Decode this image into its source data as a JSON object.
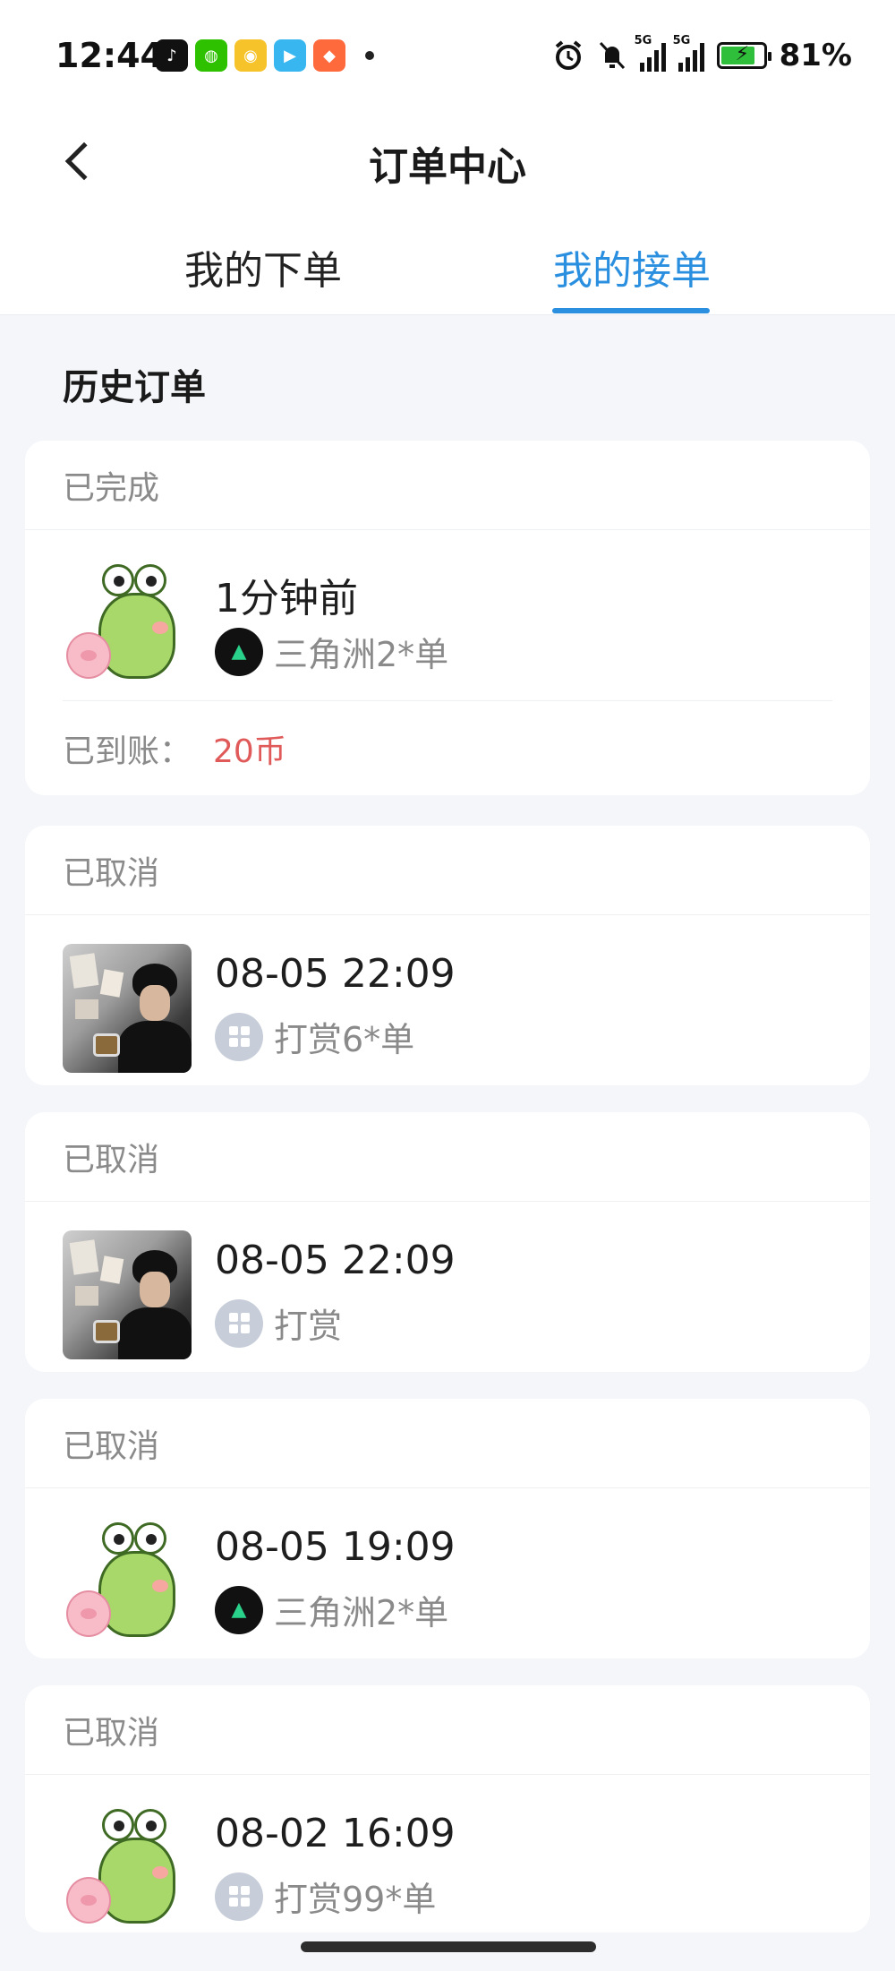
{
  "status_bar": {
    "time": "12:44",
    "battery_percent": "81%",
    "battery_level": 0.81,
    "icons": [
      "alarm-icon",
      "mute-bell-icon",
      "5g-signal-icon",
      "5g-signal-icon",
      "charging-battery-icon"
    ]
  },
  "header": {
    "title": "订单中心",
    "tabs": [
      {
        "label": "我的下单",
        "active": false
      },
      {
        "label": "我的接单",
        "active": true
      }
    ],
    "accent_color": "#2b8fe0"
  },
  "section_title": "历史订单",
  "orders": [
    {
      "status": "已完成",
      "time": "1分钟前",
      "item": "三角洲2*单",
      "game_icon": "delta-force-icon",
      "avatar": "frog-sticker",
      "paid_label": "已到账：",
      "amount": "20币"
    },
    {
      "status": "已取消",
      "time": "08-05 22:09",
      "item": "打赏6*单",
      "game_icon": "grid-app-icon",
      "avatar": "photo"
    },
    {
      "status": "已取消",
      "time": "08-05 22:09",
      "item": "打赏",
      "game_icon": "grid-app-icon",
      "avatar": "photo"
    },
    {
      "status": "已取消",
      "time": "08-05 19:09",
      "item": "三角洲2*单",
      "game_icon": "delta-force-icon",
      "avatar": "frog-sticker"
    },
    {
      "status": "已取消",
      "time": "08-02 16:09",
      "item": "打赏99*单",
      "game_icon": "grid-app-icon",
      "avatar": "frog-sticker"
    }
  ],
  "amount_color": "#e05a5a"
}
